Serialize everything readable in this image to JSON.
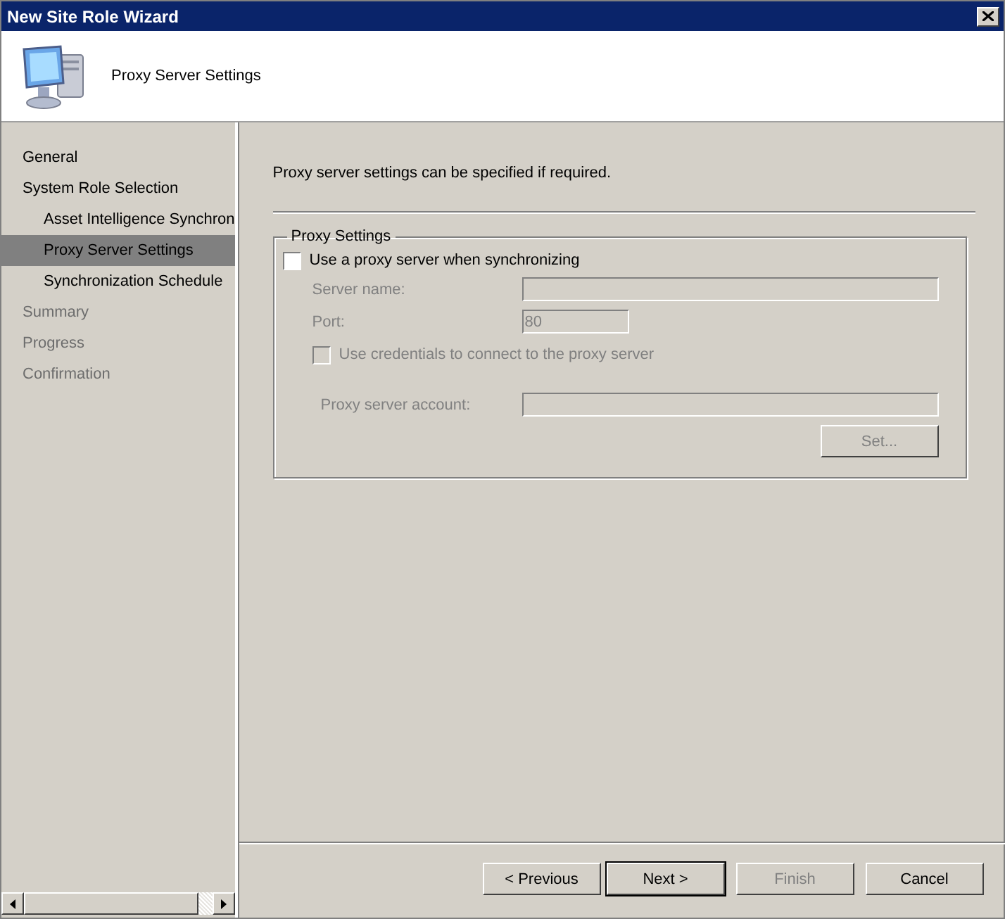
{
  "window": {
    "title": "New Site Role Wizard"
  },
  "header": {
    "title": "Proxy Server Settings"
  },
  "nav": {
    "items": [
      {
        "label": "General",
        "selected": false,
        "disabled": false
      },
      {
        "label": "System Role Selection",
        "selected": false,
        "disabled": false,
        "children": [
          {
            "label": "Asset Intelligence Synchron",
            "selected": false,
            "disabled": false
          },
          {
            "label": "Proxy Server Settings",
            "selected": true,
            "disabled": false
          },
          {
            "label": "Synchronization Schedule",
            "selected": false,
            "disabled": false
          }
        ]
      },
      {
        "label": "Summary",
        "selected": false,
        "disabled": true
      },
      {
        "label": "Progress",
        "selected": false,
        "disabled": true
      },
      {
        "label": "Confirmation",
        "selected": false,
        "disabled": true
      }
    ]
  },
  "page": {
    "description": "Proxy server settings can be specified if required.",
    "group": {
      "title": "Proxy Settings",
      "use_proxy": {
        "label": "Use a proxy server when synchronizing",
        "checked": false,
        "disabled": false
      },
      "server_name": {
        "label": "Server name:",
        "disabled": true
      },
      "port": {
        "label": "Port:",
        "value": "80",
        "disabled": true
      },
      "use_credentials": {
        "label": "Use credentials to connect to the proxy server",
        "checked": false,
        "disabled": true
      },
      "account": {
        "label": "Proxy server account:",
        "disabled": true
      },
      "set_button": {
        "label": "Set...",
        "disabled": true
      }
    }
  },
  "buttons": [
    {
      "label": "< Previous",
      "disabled": false,
      "default": false
    },
    {
      "label": "Next >",
      "disabled": false,
      "default": true
    },
    {
      "label": "Finish",
      "disabled": true,
      "default": false
    },
    {
      "label": "Cancel",
      "disabled": false,
      "default": false
    }
  ]
}
